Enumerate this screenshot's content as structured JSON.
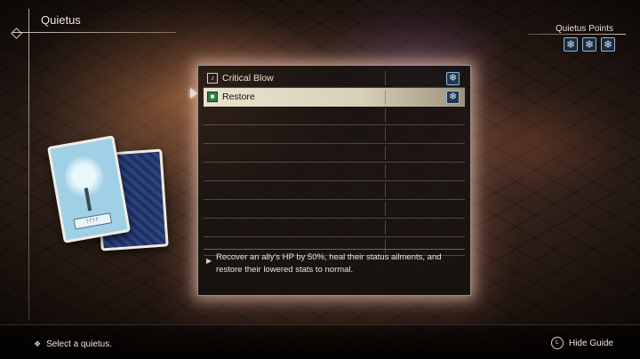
{
  "header": {
    "title": "Quietus"
  },
  "quietus_points": {
    "label": "Quietus Points",
    "icons": [
      "❄",
      "❄",
      "❄"
    ]
  },
  "list": {
    "items": [
      {
        "name": "Critical Blow",
        "icon": "♪",
        "cost_icon": "❄",
        "selected": false
      },
      {
        "name": "Restore",
        "icon": "■",
        "cost_icon": "❄",
        "selected": true
      }
    ],
    "empty_rows": 8
  },
  "description": "Recover an ally's HP by 50%, heal their status ailments, and restore their lowered stats to normal.",
  "card": {
    "plate_text": "ᚫᚫᚫᚫ"
  },
  "footer": {
    "hint": "Select a quietus.",
    "guide_label": "Hide Guide",
    "guide_button": "L"
  },
  "colors": {
    "panel_glow": "#f3d6cc",
    "cost_icon_border": "#93b9da",
    "selected_row": "#eae3cf"
  }
}
